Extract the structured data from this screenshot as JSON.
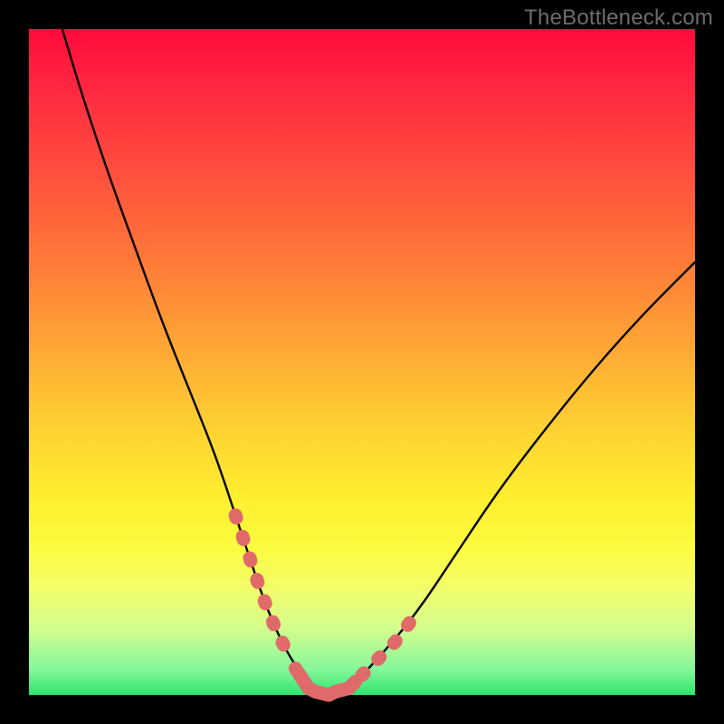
{
  "watermark": {
    "text": "TheBottleneck.com"
  },
  "colors": {
    "background": "#000000",
    "curve_stroke": "#000000",
    "highlight_stroke": "#e06a6a",
    "gradient_stops": [
      "#ff0a3a",
      "#ff4a3e",
      "#ff7a38",
      "#ffa835",
      "#ffd232",
      "#ffed2f",
      "#fbfc40",
      "#d4fd8e",
      "#2ee56f"
    ]
  },
  "chart_data": {
    "type": "line",
    "title": "",
    "xlabel": "",
    "ylabel": "",
    "xlim": [
      0,
      100
    ],
    "ylim": [
      0,
      100
    ],
    "grid": false,
    "legend": false,
    "series": [
      {
        "name": "bottleneck-curve",
        "x": [
          5,
          8,
          12,
          16,
          20,
          24,
          28,
          31,
          33,
          35,
          37,
          39,
          41,
          43,
          45,
          48,
          52,
          58,
          64,
          70,
          76,
          84,
          92,
          100
        ],
        "values": [
          100,
          90,
          78,
          67,
          56,
          46,
          36,
          27,
          21,
          15,
          10,
          6,
          3,
          1,
          0,
          1,
          5,
          12,
          21,
          30,
          38,
          48,
          57,
          65
        ]
      }
    ],
    "annotations": [
      {
        "name": "highlight-left-arm",
        "x": [
          31,
          33,
          35,
          37,
          39
        ],
        "values": [
          27,
          21,
          15,
          10,
          6
        ]
      },
      {
        "name": "highlight-bottom-flat",
        "x": [
          40,
          42,
          43,
          45,
          46,
          48,
          49
        ],
        "values": [
          4,
          1,
          0.5,
          0,
          0.5,
          1,
          2
        ]
      },
      {
        "name": "highlight-right-arm",
        "x": [
          50,
          52,
          55,
          58
        ],
        "values": [
          3,
          5,
          8,
          12
        ]
      }
    ]
  }
}
